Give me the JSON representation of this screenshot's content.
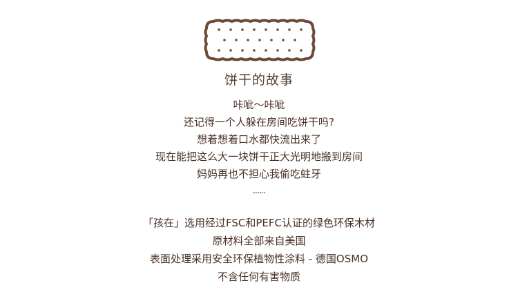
{
  "graphic": {
    "icon": "biscuit-icon",
    "outline_color": "#6b4a3a",
    "dot_color": "#6b4a3a",
    "fill_color": "#ffffff"
  },
  "story": {
    "title": "饼干的故事",
    "lines": [
      "咔呲～咔呲",
      "还记得一个人躲在房间吃饼干吗?",
      "想着想着口水都快流出来了",
      "现在能把这么大一块饼干正大光明地搬到房间",
      "妈妈再也不担心我偷吃蛀牙"
    ],
    "ellipsis": "......"
  },
  "material": {
    "lines": [
      "「孩在」选用经过FSC和PEFC认证的绿色环保木材",
      "原材料全部来自美国",
      "表面处理采用安全环保植物性涂料  -  德国OSMO",
      "不含任何有害物质"
    ]
  },
  "colors": {
    "text": "#4a3026",
    "title": "#5a3d30",
    "background": "#ffffff"
  }
}
